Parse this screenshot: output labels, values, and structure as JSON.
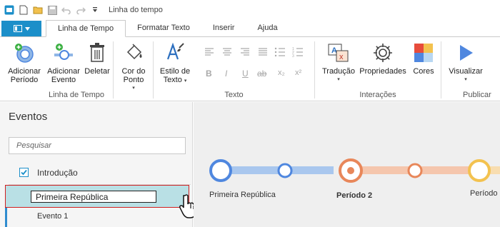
{
  "window": {
    "title": "Linha do tempo"
  },
  "tabs": [
    {
      "label": "Linha de Tempo"
    },
    {
      "label": "Formatar Texto"
    },
    {
      "label": "Inserir"
    },
    {
      "label": "Ajuda"
    }
  ],
  "ribbon": {
    "timeline_group": {
      "label": "Linha de Tempo",
      "add_period": "Adicionar Período",
      "add_event": "Adicionar Evento",
      "delete": "Deletar",
      "dot_color": "Cor do Ponto"
    },
    "text_group": {
      "label": "Texto",
      "text_style": "Estilo de Texto",
      "bold": "B",
      "italic": "I",
      "underline": "U",
      "strike": "ab",
      "subscript": "x₂",
      "superscript": "x²"
    },
    "interactions_group": {
      "label": "Interações",
      "translation": "Tradução",
      "properties": "Propriedades",
      "colors": "Cores"
    },
    "publish_group": {
      "label": "Publicar",
      "preview": "Visualizar"
    }
  },
  "panel": {
    "title": "Eventos",
    "search_placeholder": "Pesquisar",
    "items": [
      {
        "label": "Introdução"
      },
      {
        "label": "Primeira República"
      },
      {
        "label": "Evento 1"
      }
    ]
  },
  "timeline": {
    "labels": [
      "Primeira República",
      "Período 2",
      "Período"
    ]
  },
  "colors": {
    "accent": "#1c8fc9",
    "blue_track": "#a9c7ee",
    "blue_node": "#4f87df",
    "orange_track": "#f5c6ad",
    "orange_node": "#e8875a",
    "yellow_node": "#f3c24f",
    "selection_bg": "#b9e0e5",
    "selection_border": "#d11f1f"
  }
}
